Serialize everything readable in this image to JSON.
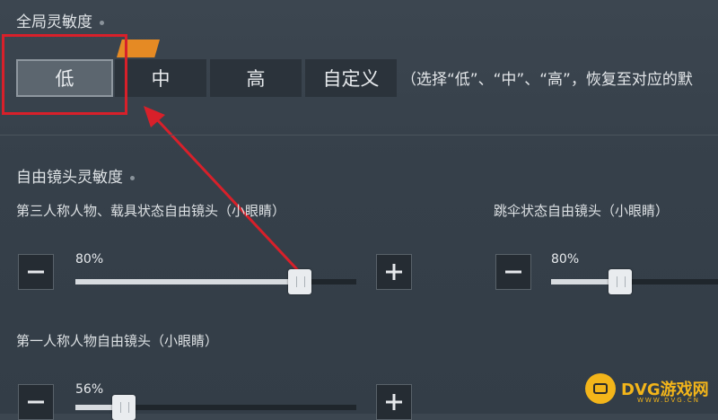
{
  "global": {
    "heading": "全局灵敏度",
    "options": [
      "低",
      "中",
      "高",
      "自定义"
    ],
    "selected": "低",
    "description": "（选择“低”、“中”、“高”，恢复至对应的默"
  },
  "free_cam": {
    "heading": "自由镜头灵敏度",
    "third_person": {
      "label": "第三人称人物、载具状态自由镜头（小眼睛）",
      "percent": "80%",
      "value": 0.8
    },
    "parachute": {
      "label": "跳伞状态自由镜头（小眼睛）",
      "percent": "80%",
      "value": 0.8
    },
    "first_person": {
      "label": "第一人称人物自由镜头（小眼睛）",
      "percent": "56%",
      "value": 0.56
    }
  },
  "watermark": {
    "text": "DVG游戏网",
    "sub": "WWW.DVG.CN"
  },
  "colors": {
    "highlight": "#d8202a",
    "badge": "#e58a24",
    "watermark": "#f3b51a"
  },
  "icons": {
    "minus": "minus-icon",
    "plus": "plus-icon"
  }
}
